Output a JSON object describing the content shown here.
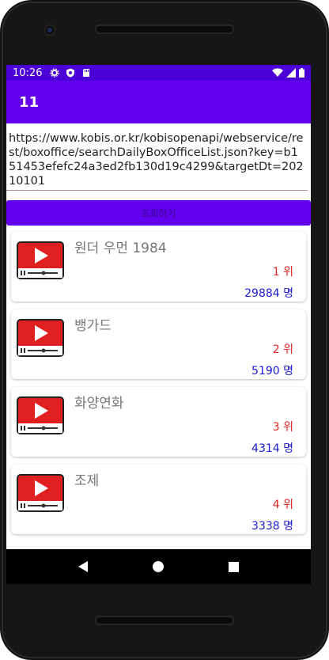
{
  "status": {
    "time": "10:26"
  },
  "appbar": {
    "title": "11"
  },
  "url": {
    "text": "https://www.kobis.or.kr/kobisopenapi/webservice/rest/boxoffice/searchDailyBoxOfficeList.json?key=b151453efefc24a3ed2fb130d19c4299&targetDt=20210101"
  },
  "action": {
    "label": "조회하기"
  },
  "movies": [
    {
      "title": "원더 우먼 1984",
      "rank": "1 위",
      "count": "29884 명"
    },
    {
      "title": "뱅가드",
      "rank": "2 위",
      "count": "5190 명"
    },
    {
      "title": "화양연화",
      "rank": "3 위",
      "count": "4314 명"
    },
    {
      "title": "조제",
      "rank": "4 위",
      "count": "3338 명"
    }
  ],
  "colors": {
    "statusbar": "#4a00d6",
    "appbar": "#6200ee",
    "rank": "#e52222",
    "count": "#1a1ad6"
  }
}
